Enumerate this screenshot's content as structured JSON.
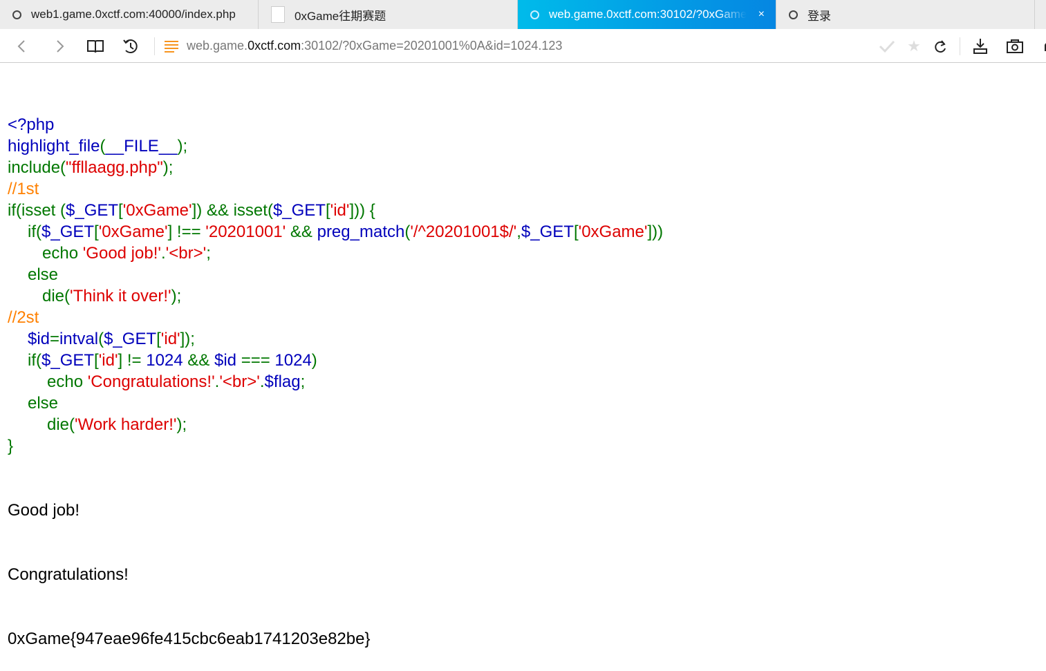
{
  "tabs": [
    {
      "title": "web1.game.0xctf.com:40000/index.php",
      "icon": "loading-ring-icon"
    },
    {
      "title": "0xGame往期赛题",
      "icon": "page-icon"
    },
    {
      "title": "web.game.0xctf.com:30102/?0xGame",
      "icon": "loading-ring-icon",
      "active": true,
      "close": "×"
    },
    {
      "title": "登录",
      "icon": "loading-ring-icon"
    }
  ],
  "address": {
    "prefix": "web.game.",
    "domain": "0xctf.com",
    "rest": ":30102/?0xGame=20201001%0A&id=1024.123"
  },
  "colors": {
    "keyword": "#007700",
    "string": "#DD0000",
    "default": "#0000BB",
    "comment": "#FF8000",
    "active_tab": "#0a9ee6"
  },
  "code": [
    {
      "indent": 0,
      "t": [
        [
          "d",
          "<?php"
        ]
      ]
    },
    {
      "indent": 0,
      "t": [
        [
          "d",
          "highlight_file"
        ],
        [
          "k",
          "("
        ],
        [
          "d",
          "__FILE__"
        ],
        [
          "k",
          ");"
        ]
      ]
    },
    {
      "indent": 0,
      "t": [
        [
          "k",
          "include("
        ],
        [
          "s",
          "\"ffllaagg.php\""
        ],
        [
          "k",
          ");"
        ]
      ]
    },
    {
      "indent": 0,
      "t": [
        [
          "c",
          "//1st"
        ]
      ]
    },
    {
      "indent": 0,
      "t": [
        [
          "k",
          "if(isset ("
        ],
        [
          "d",
          "$_GET"
        ],
        [
          "k",
          "["
        ],
        [
          "s",
          "'0xGame'"
        ],
        [
          "k",
          "]) && isset("
        ],
        [
          "d",
          "$_GET"
        ],
        [
          "k",
          "["
        ],
        [
          "s",
          "'id'"
        ],
        [
          "k",
          "])) {"
        ]
      ]
    },
    {
      "indent": 1,
      "t": [
        [
          "k",
          "if("
        ],
        [
          "d",
          "$_GET"
        ],
        [
          "k",
          "["
        ],
        [
          "s",
          "'0xGame'"
        ],
        [
          "k",
          "] !== "
        ],
        [
          "s",
          "'20201001'"
        ],
        [
          "k",
          " && "
        ],
        [
          "d",
          "preg_match"
        ],
        [
          "k",
          "("
        ],
        [
          "s",
          "'/^20201001$/'"
        ],
        [
          "k",
          ","
        ],
        [
          "d",
          "$_GET"
        ],
        [
          "k",
          "["
        ],
        [
          "s",
          "'0xGame'"
        ],
        [
          "k",
          "]))"
        ]
      ]
    },
    {
      "indent": 2,
      "t": [
        [
          "k",
          "echo "
        ],
        [
          "s",
          "'Good job!'"
        ],
        [
          "k",
          "."
        ],
        [
          "s",
          "'<br>'"
        ],
        [
          "k",
          ";"
        ]
      ]
    },
    {
      "indent": 1,
      "t": [
        [
          "k",
          "else"
        ]
      ]
    },
    {
      "indent": 2,
      "t": [
        [
          "k",
          "die("
        ],
        [
          "s",
          "'Think it over!'"
        ],
        [
          "k",
          ");"
        ]
      ]
    },
    {
      "indent": 0,
      "t": [
        [
          "c",
          "//2st"
        ]
      ]
    },
    {
      "indent": 1,
      "t": [
        [
          "d",
          "$id"
        ],
        [
          "k",
          "="
        ],
        [
          "d",
          "intval"
        ],
        [
          "k",
          "("
        ],
        [
          "d",
          "$_GET"
        ],
        [
          "k",
          "["
        ],
        [
          "s",
          "'id'"
        ],
        [
          "k",
          "]);"
        ]
      ]
    },
    {
      "indent": 1,
      "t": [
        [
          "k",
          "if("
        ],
        [
          "d",
          "$_GET"
        ],
        [
          "k",
          "["
        ],
        [
          "s",
          "'id'"
        ],
        [
          "k",
          "] != "
        ],
        [
          "d",
          "1024 "
        ],
        [
          "k",
          "&& "
        ],
        [
          "d",
          "$id "
        ],
        [
          "k",
          "=== "
        ],
        [
          "d",
          "1024"
        ],
        [
          "k",
          ")"
        ]
      ]
    },
    {
      "indent": 3,
      "t": [
        [
          "k",
          "echo "
        ],
        [
          "s",
          "'Congratulations!'"
        ],
        [
          "k",
          "."
        ],
        [
          "s",
          "'<br>'"
        ],
        [
          "k",
          "."
        ],
        [
          "d",
          "$flag"
        ],
        [
          "k",
          ";"
        ]
      ]
    },
    {
      "indent": 1,
      "t": [
        [
          "k",
          "else"
        ]
      ]
    },
    {
      "indent": 3,
      "t": [
        [
          "k",
          "die("
        ],
        [
          "s",
          "'Work harder!'"
        ],
        [
          "k",
          ");"
        ]
      ]
    },
    {
      "indent": 0,
      "t": [
        [
          "k",
          "}"
        ]
      ]
    }
  ],
  "output": [
    "Good job!",
    "Congratulations!",
    "0xGame{947eae96fe415cbc6eab1741203e82be}"
  ]
}
